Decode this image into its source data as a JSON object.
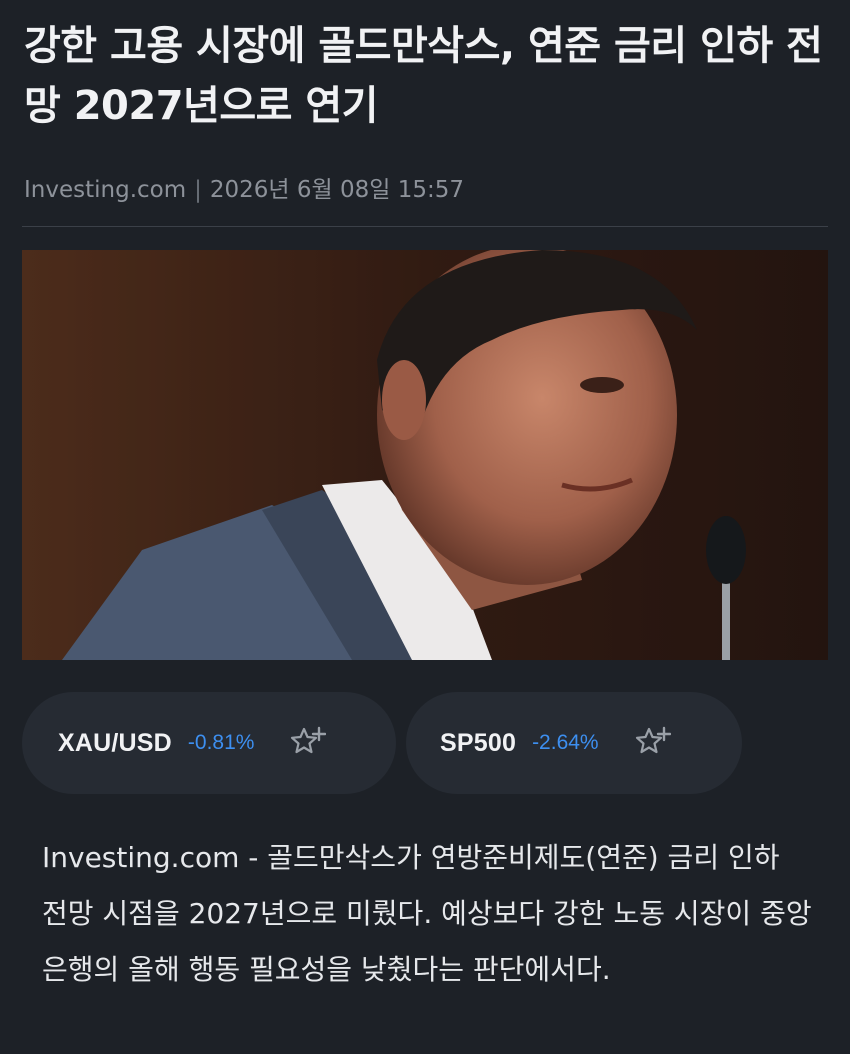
{
  "article": {
    "headline": "강한 고용 시장에 골드만삭스, 연준 금리 인하 전망 2027년으로 연기",
    "source": "Investing.com",
    "separator": "|",
    "datetime": "2026년 6월 08일 15:57",
    "body": "Investing.com - 골드만삭스가 연방준비제도(연준) 금리 인하 전망 시점을 2027년으로 미뤘다. 예상보다 강한 노동 시장이 중앙은행의 올해 행동 필요성을 낮췄다는 판단에서다."
  },
  "tickers": [
    {
      "symbol": "XAU/USD",
      "change": "-0.81%",
      "icon": "star-plus-icon"
    },
    {
      "symbol": "SP500",
      "change": "-2.64%",
      "icon": "star-plus-icon"
    }
  ],
  "colors": {
    "background": "#1d2127",
    "pill": "#262b33",
    "negative_change": "#3d8ff0",
    "muted_text": "#8d929a"
  }
}
